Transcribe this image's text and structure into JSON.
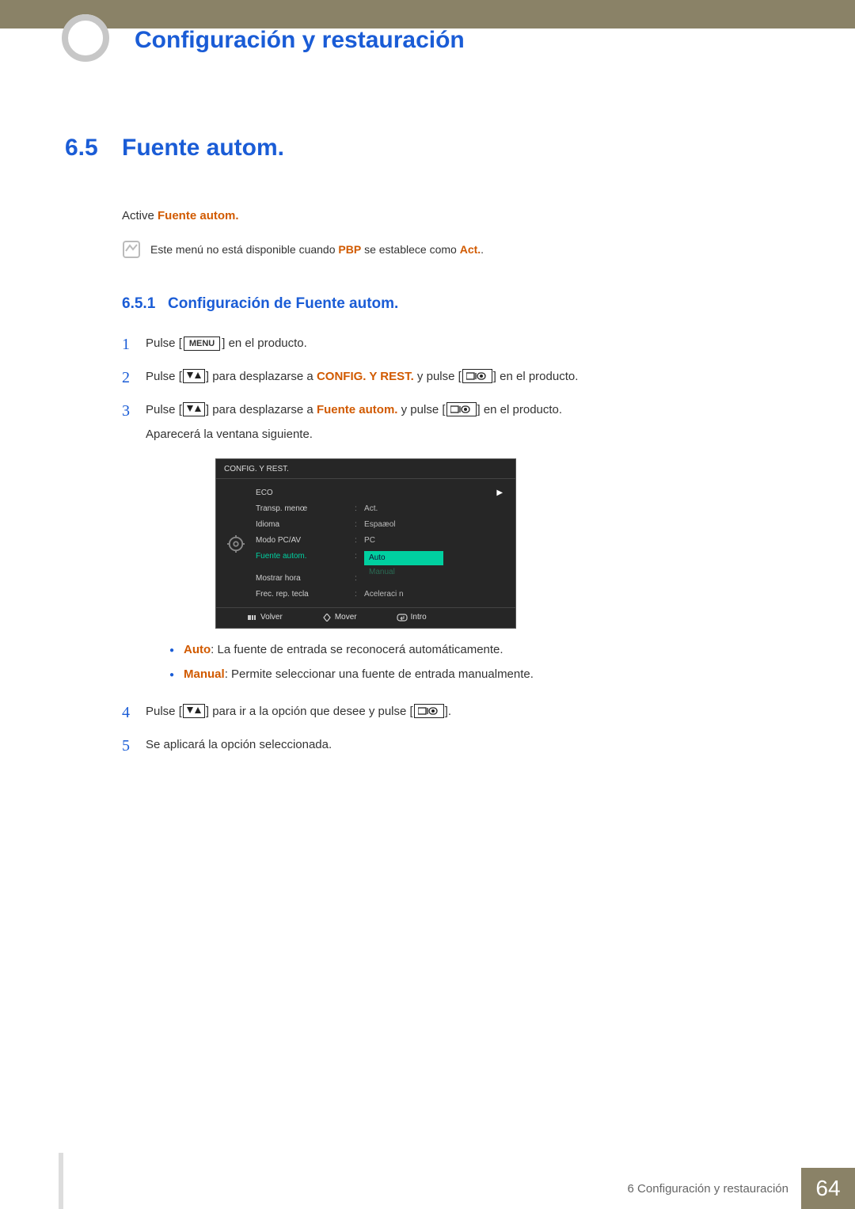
{
  "header": {
    "title": "Configuración y restauración"
  },
  "section": {
    "number": "6.5",
    "title": "Fuente autom."
  },
  "intro": {
    "prefix": "Active ",
    "highlight": "Fuente autom."
  },
  "note": {
    "text_a": "Este menú no está disponible cuando ",
    "pbp": "PBP",
    "text_b": " se establece como ",
    "act": "Act.",
    "text_c": "."
  },
  "subsection": {
    "number": "6.5.1",
    "title": "Configuración de Fuente autom."
  },
  "steps": {
    "s1": {
      "num": "1",
      "a": "Pulse [",
      "menu": "MENU",
      "b": "] en el producto."
    },
    "s2": {
      "num": "2",
      "a": "Pulse [",
      "b": "] para desplazarse a ",
      "target": "CONFIG. Y REST.",
      "c": " y pulse [",
      "d": "] en el producto."
    },
    "s3": {
      "num": "3",
      "a": "Pulse [",
      "b": "] para desplazarse a ",
      "target": "Fuente autom.",
      "c": " y pulse [",
      "d": "] en el producto.",
      "follow": "Aparecerá la ventana siguiente."
    },
    "s4": {
      "num": "4",
      "a": "Pulse [",
      "b": "] para ir a la opción que desee y pulse [",
      "c": "]."
    },
    "s5": {
      "num": "5",
      "text": "Se aplicará la opción seleccionada."
    }
  },
  "osd": {
    "title": "CONFIG. Y REST.",
    "rows": {
      "eco": {
        "label": "ECO",
        "value": ""
      },
      "transp": {
        "label": "Transp. menœ",
        "value": "Act."
      },
      "idioma": {
        "label": "Idioma",
        "value": "Espaæol"
      },
      "modo": {
        "label": "Modo PC/AV",
        "value": "PC"
      },
      "fuente": {
        "label": "Fuente autom.",
        "opt_auto": "Auto",
        "opt_manual": "Manual"
      },
      "mostrar": {
        "label": "Mostrar hora",
        "value": ""
      },
      "frec": {
        "label": "Frec. rep. tecla",
        "value": "Aceleraci n"
      }
    },
    "footer": {
      "volver": "Volver",
      "mover": "Mover",
      "intro": "Intro"
    }
  },
  "bullets": {
    "auto": {
      "label": "Auto",
      "text": ": La fuente de entrada se reconocerá automáticamente."
    },
    "manual": {
      "label": "Manual",
      "text": ": Permite seleccionar una fuente de entrada manualmente."
    }
  },
  "footer": {
    "chapter": "6 Configuración y restauración",
    "page": "64"
  },
  "icons": {
    "arrow_up_down": "▼/▲",
    "rect_slash": "▭/⏎"
  }
}
